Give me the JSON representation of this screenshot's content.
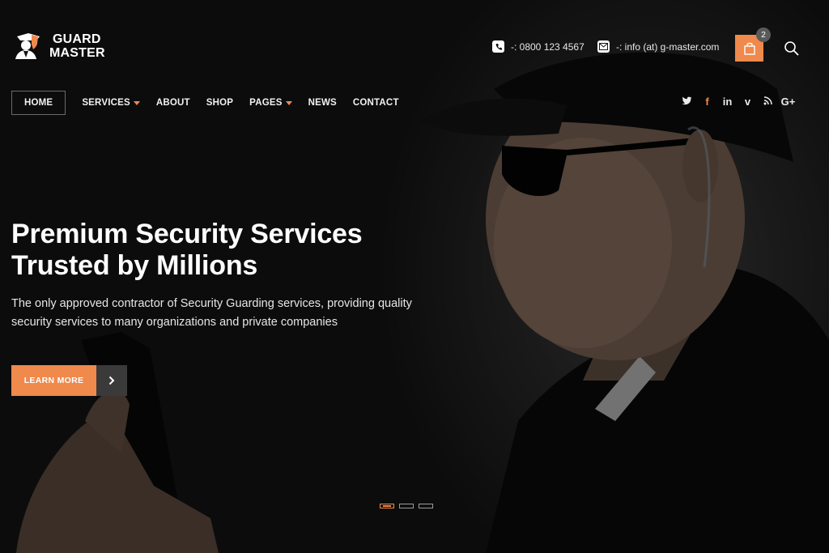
{
  "brand": {
    "line1": "GUARD",
    "line2": "MASTER",
    "accent": "#f0894c"
  },
  "header": {
    "phone": "-: 0800 123 4567",
    "email": "-: info (at) g-master.com",
    "cart_count": "2",
    "icons": [
      "phone-icon",
      "mail-icon",
      "shopping-bag-icon",
      "search-icon"
    ]
  },
  "nav": {
    "items": [
      {
        "label": "HOME",
        "active": true
      },
      {
        "label": "SERVICES",
        "dropdown": true
      },
      {
        "label": "ABOUT"
      },
      {
        "label": "SHOP"
      },
      {
        "label": "PAGES",
        "dropdown": true
      },
      {
        "label": "NEWS"
      },
      {
        "label": "CONTACT"
      }
    ]
  },
  "social": {
    "twitter": "🐦",
    "facebook": "f",
    "linkedin": "in",
    "vimeo": "v",
    "rss": "☷",
    "googleplus": "G+"
  },
  "hero": {
    "headline_line1": "Premium Security Services",
    "headline_line2": "Trusted by Millions",
    "subtext_line1": "The only approved contractor of Security Guarding services, providing quality",
    "subtext_line2": "security services to many organizations and private companies",
    "cta_label": "LEARN MORE"
  },
  "slider": {
    "slide_count": 3,
    "active_index": 0
  }
}
